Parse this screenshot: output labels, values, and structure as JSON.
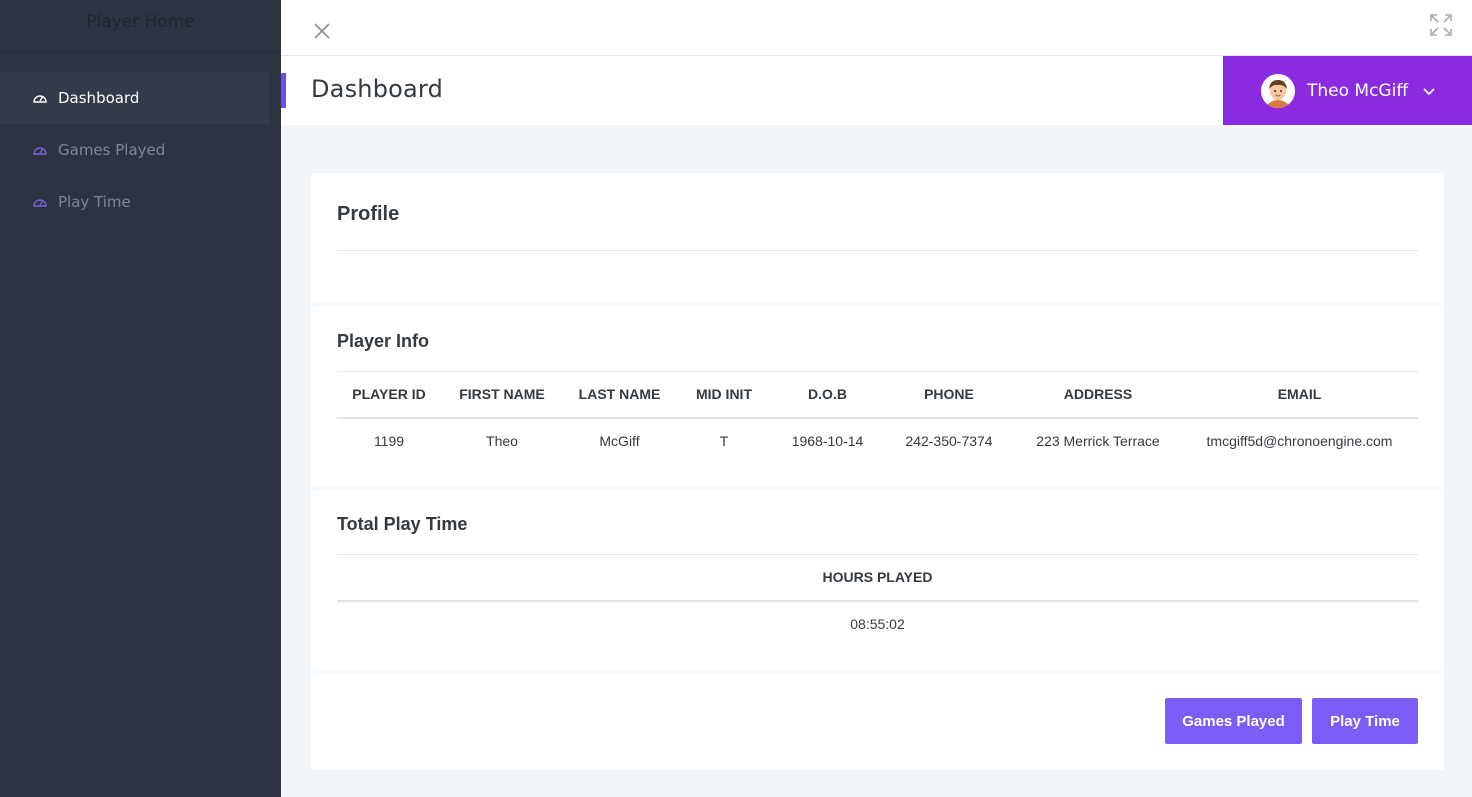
{
  "sidebar": {
    "brand": "Player Home",
    "items": [
      {
        "label": "Dashboard",
        "icon": "dashboard-gauge-icon",
        "active": true
      },
      {
        "label": "Games Played",
        "icon": "dashboard-gauge-icon",
        "active": false
      },
      {
        "label": "Play Time",
        "icon": "dashboard-gauge-icon",
        "active": false
      }
    ]
  },
  "topbar": {
    "close_icon": "close-icon",
    "expand_icon": "expand-icon"
  },
  "header": {
    "title": "Dashboard",
    "user": {
      "name": "Theo McGiff",
      "avatar_icon": "avatar-icon",
      "menu_icon": "chevron-down-icon"
    }
  },
  "profile": {
    "title": "Profile",
    "player_info": {
      "title": "Player Info",
      "columns": [
        "PLAYER ID",
        "FIRST NAME",
        "LAST NAME",
        "MID INIT",
        "D.O.B",
        "PHONE",
        "ADDRESS",
        "EMAIL"
      ],
      "rows": [
        [
          "1199",
          "Theo",
          "McGiff",
          "T",
          "1968-10-14",
          "242-350-7374",
          "223 Merrick Terrace",
          "tmcgiff5d@chronoengine.com"
        ]
      ]
    },
    "play_time": {
      "title": "Total Play Time",
      "columns": [
        "HOURS PLAYED"
      ],
      "rows": [
        [
          "08:55:02"
        ]
      ]
    },
    "buttons": {
      "games_played": "Games Played",
      "play_time": "Play Time"
    }
  },
  "colors": {
    "sidebar_bg": "#2d3341",
    "accent": "#6a4cff",
    "user_menu_bg": "#8a2be2",
    "button_bg": "#7b5cf5"
  }
}
